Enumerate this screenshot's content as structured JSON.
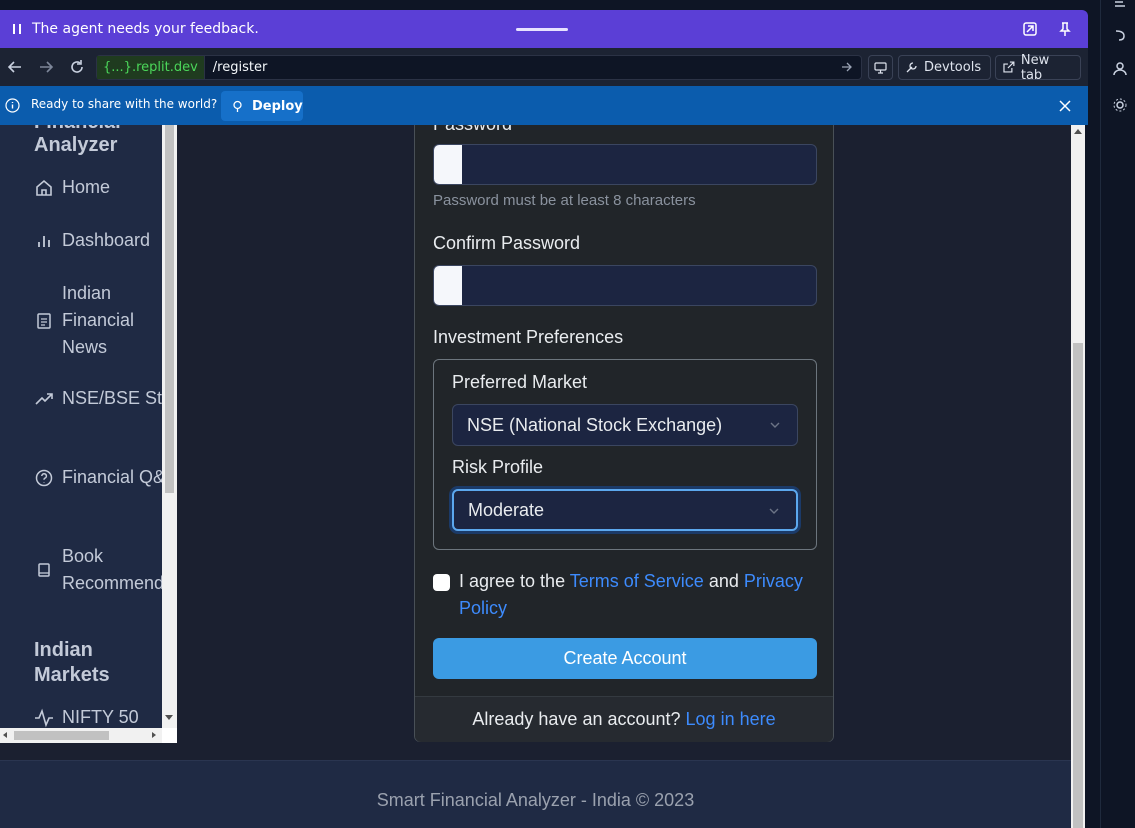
{
  "feedback_bar": {
    "message": "The agent needs your feedback.",
    "icons": [
      "pause-icon",
      "expand-icon",
      "pin-icon"
    ]
  },
  "browser": {
    "url_host": "{...}.replit.dev",
    "url_path": "/register",
    "devtools_label": "Devtools",
    "new_tab_label": "New tab"
  },
  "deploy_bar": {
    "message": "Ready to share with the world?",
    "deploy_label": "Deploy"
  },
  "sidebar": {
    "brand_line1": "Financial",
    "brand_line2": "Analyzer",
    "items": [
      {
        "label": "Home",
        "icon": "home-icon"
      },
      {
        "label": "Dashboard",
        "icon": "bar-chart-icon"
      },
      {
        "label": "Indian Financial News",
        "icon": "newspaper-icon"
      },
      {
        "label": "NSE/BSE Stocks",
        "icon": "trending-up-icon"
      },
      {
        "label": "Financial Q&A",
        "icon": "help-circle-icon"
      },
      {
        "label": "Book Recommendations",
        "icon": "book-icon"
      }
    ],
    "section_title": "Indian Markets",
    "market_items": [
      {
        "label": "NIFTY 50",
        "icon": "activity-icon"
      }
    ]
  },
  "form": {
    "password_label": "Password",
    "password_help": "Password must be at least 8 characters",
    "confirm_label": "Confirm Password",
    "prefs_title": "Investment Preferences",
    "market_label": "Preferred Market",
    "market_value": "NSE (National Stock Exchange)",
    "risk_label": "Risk Profile",
    "risk_value": "Moderate",
    "agree_prefix": "I agree to the",
    "terms_link": "Terms of Service",
    "agree_and": "and",
    "privacy_link": "Privacy Policy",
    "submit_label": "Create Account",
    "login_prompt": "Already have an account?",
    "login_link": "Log in here"
  },
  "footer": {
    "text": "Smart Financial Analyzer - India © 2023"
  },
  "colors": {
    "feedback_bar": "#5b3fd6",
    "deploy_bar": "#0b5cad",
    "sidebar_bg": "#1f2a44",
    "card_bg": "#212529",
    "primary_button": "#3b9be3",
    "link": "#3d8bfd"
  }
}
